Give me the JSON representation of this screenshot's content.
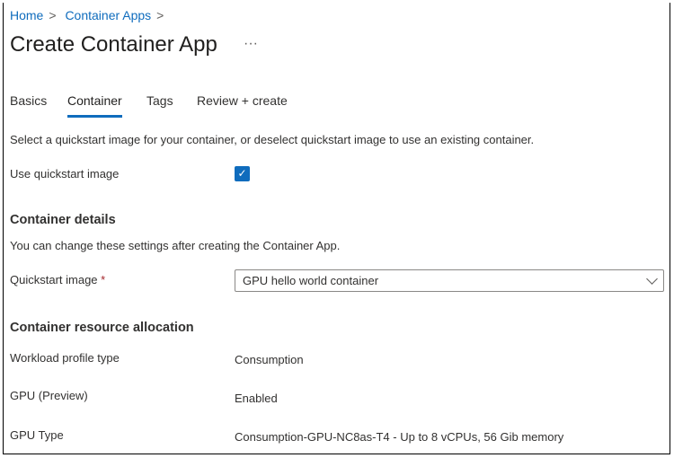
{
  "breadcrumb": [
    "Home",
    "Container Apps"
  ],
  "breadcrumb_sep": ">",
  "title": "Create Container App",
  "more": "···",
  "tabs": [
    "Basics",
    "Container",
    "Tags",
    "Review + create"
  ],
  "intro": "Select a quickstart image for your container, or deselect quickstart image to use an existing container.",
  "use_quickstart": {
    "label": "Use quickstart image",
    "checked": true,
    "check": "✓"
  },
  "details": {
    "heading": "Container details",
    "note": "You can change these settings after creating the Container App.",
    "quickstart_label": "Quickstart image",
    "required": "*",
    "quickstart_value": "GPU hello world container"
  },
  "resource": {
    "heading": "Container resource allocation",
    "rows": [
      {
        "label": "Workload profile type",
        "value": "Consumption"
      },
      {
        "label": "GPU (Preview)",
        "value": "Enabled"
      },
      {
        "label": "GPU Type",
        "value": "Consumption-GPU-NC8as-T4 - Up to 8 vCPUs, 56 Gib memory"
      }
    ]
  }
}
